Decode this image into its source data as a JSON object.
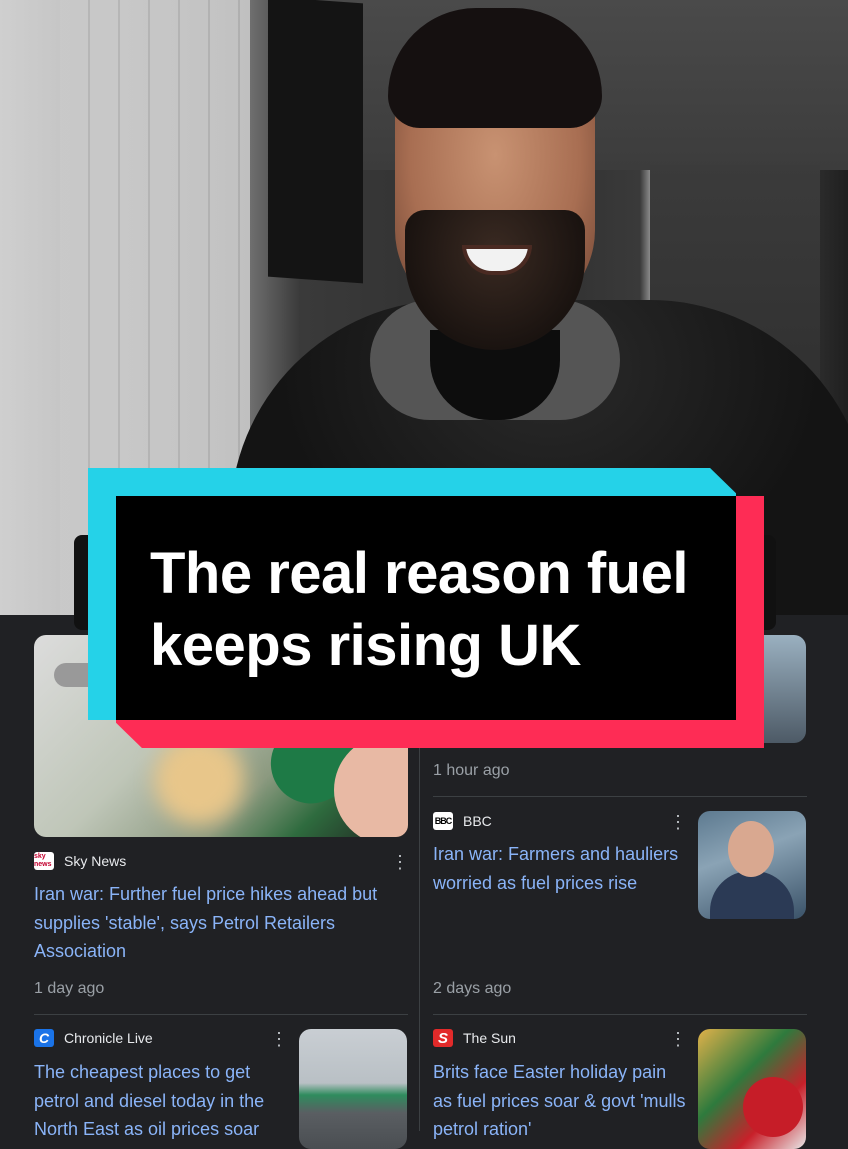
{
  "overlay": {
    "title_line1": "The real reason fuel",
    "title_line2": "keeps rising UK"
  },
  "feed": {
    "left_column": [
      {
        "source": "Sky News",
        "source_logo": "sky-news-logo",
        "headline": "Iran war: Further fuel price hikes ahead but supplies 'stable', says Petrol Retailers Association",
        "time": "1 day ago"
      },
      {
        "source": "Chronicle Live",
        "source_logo": "chronicle-live-logo",
        "headline": "The cheapest places to get petrol and diesel today in the North East as oil prices soar"
      }
    ],
    "right_column": [
      {
        "time": "1 hour ago"
      },
      {
        "source": "BBC",
        "source_logo": "bbc-logo",
        "headline": "Iran war: Farmers and hauliers worried as fuel prices rise",
        "time": "2 days ago"
      },
      {
        "source": "The Sun",
        "source_logo": "the-sun-logo",
        "headline": "Brits face Easter holiday pain as fuel prices soar & govt 'mulls petrol ration'"
      }
    ],
    "logo_text": {
      "sky": "sky news",
      "bbc": "BBC",
      "chronicle": "C",
      "sun": "S"
    }
  },
  "colors": {
    "banner_cyan": "#25d2e8",
    "banner_red": "#fe2c55",
    "headline_link": "#8ab4f8",
    "feed_background": "#202124"
  }
}
